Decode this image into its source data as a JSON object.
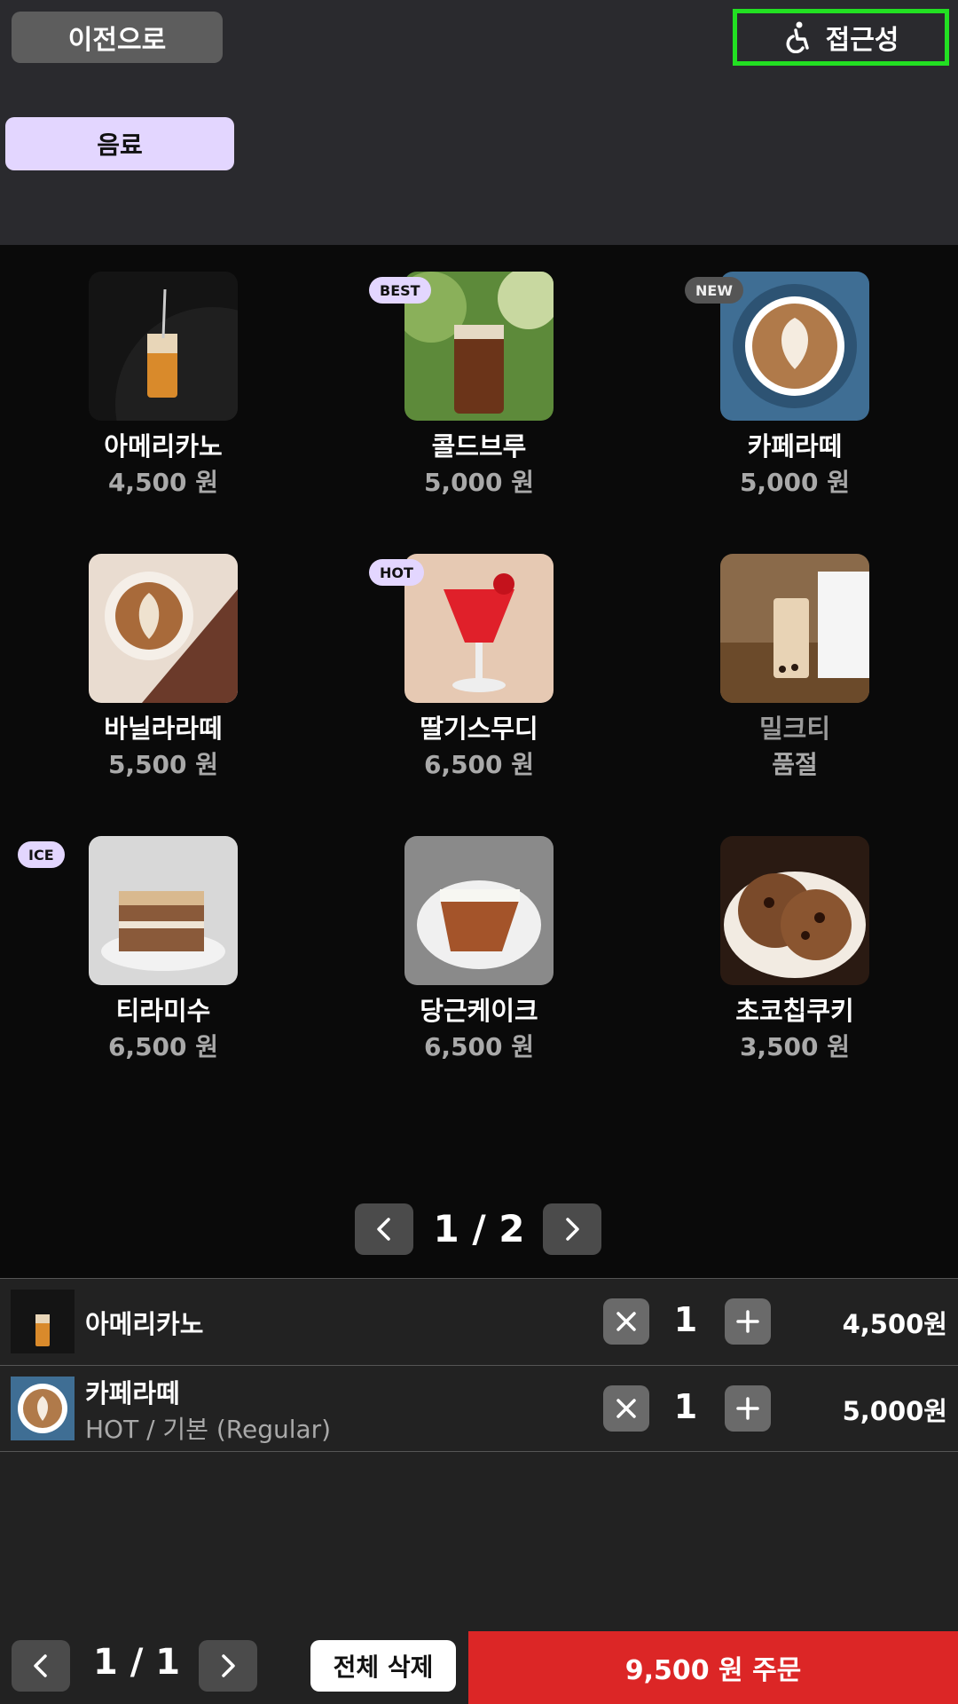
{
  "header": {
    "back_label": "이전으로",
    "accessibility_label": "접근성",
    "category_label": "음료"
  },
  "menu": {
    "items": [
      {
        "name": "아메리카노",
        "price": "4,500 원",
        "badge": ""
      },
      {
        "name": "콜드브루",
        "price": "5,000 원",
        "badge": "BEST"
      },
      {
        "name": "카페라떼",
        "price": "5,000 원",
        "badge": "NEW"
      },
      {
        "name": "바닐라라떼",
        "price": "5,500 원",
        "badge": ""
      },
      {
        "name": "딸기스무디",
        "price": "6,500 원",
        "badge": "HOT"
      },
      {
        "name": "밀크티",
        "price": "품절",
        "badge": ""
      },
      {
        "name": "티라미수",
        "price": "6,500 원",
        "badge": "ICE"
      },
      {
        "name": "당근케이크",
        "price": "6,500 원",
        "badge": ""
      },
      {
        "name": "초코칩쿠키",
        "price": "3,500 원",
        "badge": ""
      }
    ],
    "page_indicator": "1 / 2"
  },
  "cart": {
    "rows": [
      {
        "name": "아메리카노",
        "option": "",
        "qty": "1",
        "price": "4,500원"
      },
      {
        "name": "카페라떼",
        "option": "HOT / 기본 (Regular)",
        "qty": "1",
        "price": "5,000원"
      }
    ],
    "page_indicator": "1 / 1",
    "clear_label": "전체 삭제",
    "order_label": "9,500 원 주문"
  },
  "colors": {
    "accent": "#e3d6ff",
    "order": "#dc2626",
    "focus": "#22e022"
  }
}
